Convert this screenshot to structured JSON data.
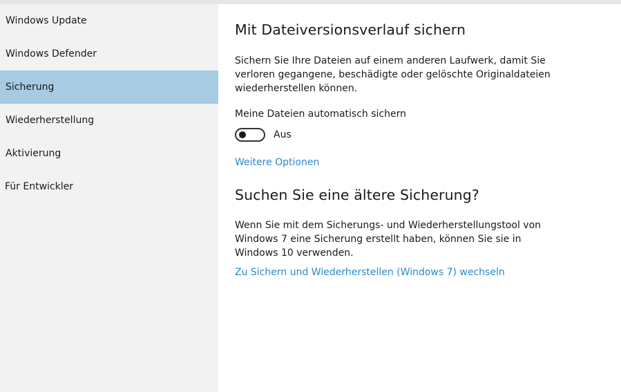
{
  "sidebar": {
    "items": [
      {
        "label": "Windows Update",
        "selected": false
      },
      {
        "label": "Windows Defender",
        "selected": false
      },
      {
        "label": "Sicherung",
        "selected": true
      },
      {
        "label": "Wiederherstellung",
        "selected": false
      },
      {
        "label": "Aktivierung",
        "selected": false
      },
      {
        "label": "Für Entwickler",
        "selected": false
      }
    ]
  },
  "main": {
    "section1": {
      "heading": "Mit Dateiversionsverlauf sichern",
      "description_lines": [
        "Sichern Sie Ihre Dateien auf einem anderen Laufwerk, damit Sie",
        "verloren gegangene, beschädigte oder gelöschte Originaldateien",
        "wiederherstellen können."
      ],
      "auto_backup_label": "Meine Dateien automatisch sichern",
      "toggle_state_label": "Aus",
      "toggle_on": false,
      "more_options_link": "Weitere Optionen"
    },
    "section2": {
      "heading": "Suchen Sie eine ältere Sicherung?",
      "description_lines": [
        "Wenn Sie mit dem Sicherungs- und Wiederherstellungstool von",
        "Windows 7 eine Sicherung erstellt haben, können Sie sie in",
        "Windows 10 verwenden."
      ],
      "link": "Zu Sichern und Wiederherstellen (Windows 7) wechseln"
    }
  },
  "colors": {
    "sidebar_background": "#f2f2f2",
    "selected_item": "#a6cbe2",
    "link": "#2b8ac9",
    "text": "#1a1a1a"
  }
}
